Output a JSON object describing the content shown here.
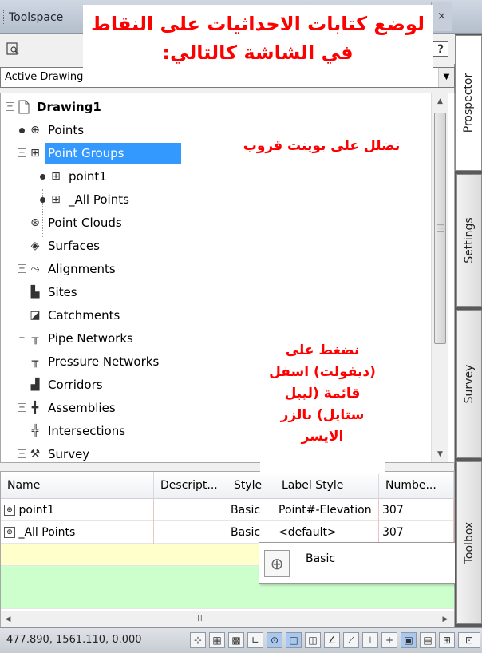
{
  "window": {
    "title": "Toolspace",
    "close_glyph": "×"
  },
  "toolbar": {
    "icons": [
      "preview-icon",
      "help-icon"
    ],
    "help_glyph": "?"
  },
  "view_selector": {
    "value": "Active Drawing View"
  },
  "tree": {
    "root": "Drawing1",
    "items": [
      {
        "label": "Points",
        "icon": "points-icon",
        "expander": "bullet"
      },
      {
        "label": "Point Groups",
        "icon": "point-groups-icon",
        "expander": "minus"
      },
      {
        "label": "point1",
        "icon": "point-group-icon",
        "expander": "bullet"
      },
      {
        "label": "_All Points",
        "icon": "point-group-icon",
        "expander": "bullet"
      },
      {
        "label": "Point Clouds",
        "icon": "point-clouds-icon",
        "expander": "none"
      },
      {
        "label": "Surfaces",
        "icon": "surfaces-icon",
        "expander": "none"
      },
      {
        "label": "Alignments",
        "icon": "alignments-icon",
        "expander": "plus"
      },
      {
        "label": "Sites",
        "icon": "sites-icon",
        "expander": "none"
      },
      {
        "label": "Catchments",
        "icon": "catchments-icon",
        "expander": "none"
      },
      {
        "label": "Pipe Networks",
        "icon": "pipe-networks-icon",
        "expander": "plus"
      },
      {
        "label": "Pressure Networks",
        "icon": "pressure-networks-icon",
        "expander": "none"
      },
      {
        "label": "Corridors",
        "icon": "corridors-icon",
        "expander": "none"
      },
      {
        "label": "Assemblies",
        "icon": "assemblies-icon",
        "expander": "plus"
      },
      {
        "label": "Intersections",
        "icon": "intersections-icon",
        "expander": "none"
      },
      {
        "label": "Survey",
        "icon": "survey-icon",
        "expander": "plus"
      }
    ]
  },
  "grid": {
    "columns": [
      "Name",
      "Descript...",
      "Style",
      "Label Style",
      "Numbe..."
    ],
    "rows": [
      {
        "name": "point1",
        "description": "",
        "style": "Basic",
        "label_style": "Point#-Elevation",
        "number": "307"
      },
      {
        "name": "_All Points",
        "description": "",
        "style": "Basic",
        "label_style": "<default>",
        "number": "307"
      }
    ],
    "hscroll_grip": "III"
  },
  "popup": {
    "label": "Basic",
    "icon": "style-icon"
  },
  "side_tabs": [
    {
      "label": "Prospector",
      "active": true
    },
    {
      "label": "Settings",
      "active": false
    },
    {
      "label": "Survey",
      "active": false
    },
    {
      "label": "Toolbox",
      "active": false
    }
  ],
  "status_bar": {
    "coordinates": "477.890, 1561.110, 0.000"
  },
  "annotations": {
    "top_line1": "لوضع كتابات الاحداثيات على النقاط",
    "top_line2": "في الشاشة كالتالي:",
    "middle": "نضلل على بوينت قروب",
    "lower": [
      "نضغط على",
      "(ديفولت) اسفل",
      "قائمة (ليبل",
      "ستايل) بالزر",
      "الايسر"
    ]
  },
  "colors": {
    "selection": "#3399ff",
    "annotation_text": "#ff0000",
    "row_yellow": "#ffffcc",
    "row_green": "#ccffcc"
  }
}
